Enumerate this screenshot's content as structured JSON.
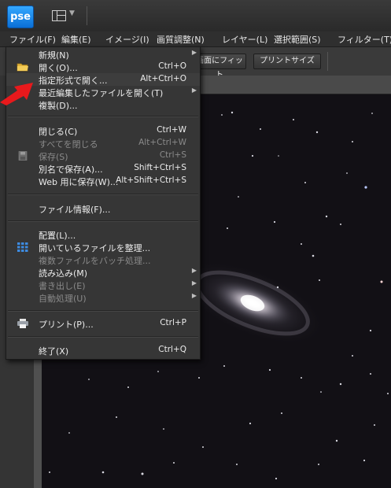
{
  "app": {
    "logo_text": "pse"
  },
  "menubar": {
    "items": [
      {
        "label": "ファイル(F)"
      },
      {
        "label": "編集(E)"
      },
      {
        "label": "イメージ(I)"
      },
      {
        "label": "画質調整(N)"
      },
      {
        "label": "レイヤー(L)"
      },
      {
        "label": "選択範囲(S)"
      },
      {
        "label": "フィルター(T)"
      }
    ]
  },
  "options": {
    "fit_screen_label": "画面にフィット",
    "print_size_label": "プリントサイズ"
  },
  "file_menu": {
    "items": [
      {
        "label": "新規(N)",
        "shortcut": "",
        "submenu": true,
        "enabled": true
      },
      {
        "label": "開く(O)...",
        "shortcut": "Ctrl+O",
        "submenu": false,
        "enabled": true,
        "icon": "folder-icon"
      },
      {
        "label": "指定形式で開く...",
        "shortcut": "Alt+Ctrl+O",
        "submenu": false,
        "enabled": true
      },
      {
        "label": "最近編集したファイルを開く(T)",
        "shortcut": "",
        "submenu": true,
        "enabled": true
      },
      {
        "label": "複製(D)...",
        "shortcut": "",
        "submenu": false,
        "enabled": true
      },
      {
        "label": "閉じる(C)",
        "shortcut": "Ctrl+W",
        "submenu": false,
        "enabled": true
      },
      {
        "label": "すべてを閉じる",
        "shortcut": "Alt+Ctrl+W",
        "submenu": false,
        "enabled": false
      },
      {
        "label": "保存(S)",
        "shortcut": "Ctrl+S",
        "submenu": false,
        "enabled": false,
        "icon": "save-icon"
      },
      {
        "label": "別名で保存(A)...",
        "shortcut": "Shift+Ctrl+S",
        "submenu": false,
        "enabled": true
      },
      {
        "label": "Web 用に保存(W)...",
        "shortcut": "Alt+Shift+Ctrl+S",
        "submenu": false,
        "enabled": true
      },
      {
        "label": "ファイル情報(F)...",
        "shortcut": "",
        "submenu": false,
        "enabled": true
      },
      {
        "label": "配置(L)...",
        "shortcut": "",
        "submenu": false,
        "enabled": true
      },
      {
        "label": "開いているファイルを整理...",
        "shortcut": "",
        "submenu": false,
        "enabled": true,
        "icon": "organize-grid-icon"
      },
      {
        "label": "複数ファイルをバッチ処理...",
        "shortcut": "",
        "submenu": false,
        "enabled": false
      },
      {
        "label": "読み込み(M)",
        "shortcut": "",
        "submenu": true,
        "enabled": true
      },
      {
        "label": "書き出し(E)",
        "shortcut": "",
        "submenu": true,
        "enabled": false
      },
      {
        "label": "自動処理(U)",
        "shortcut": "",
        "submenu": true,
        "enabled": false
      },
      {
        "label": "プリント(P)...",
        "shortcut": "Ctrl+P",
        "submenu": false,
        "enabled": true,
        "icon": "printer-icon"
      },
      {
        "label": "終了(X)",
        "shortcut": "Ctrl+Q",
        "submenu": false,
        "enabled": true
      }
    ]
  },
  "colors": {
    "accent": "#1e8af0",
    "annotation_arrow": "#e8191c",
    "menu_bg": "#363636",
    "disabled_text": "#8a8a8a"
  }
}
